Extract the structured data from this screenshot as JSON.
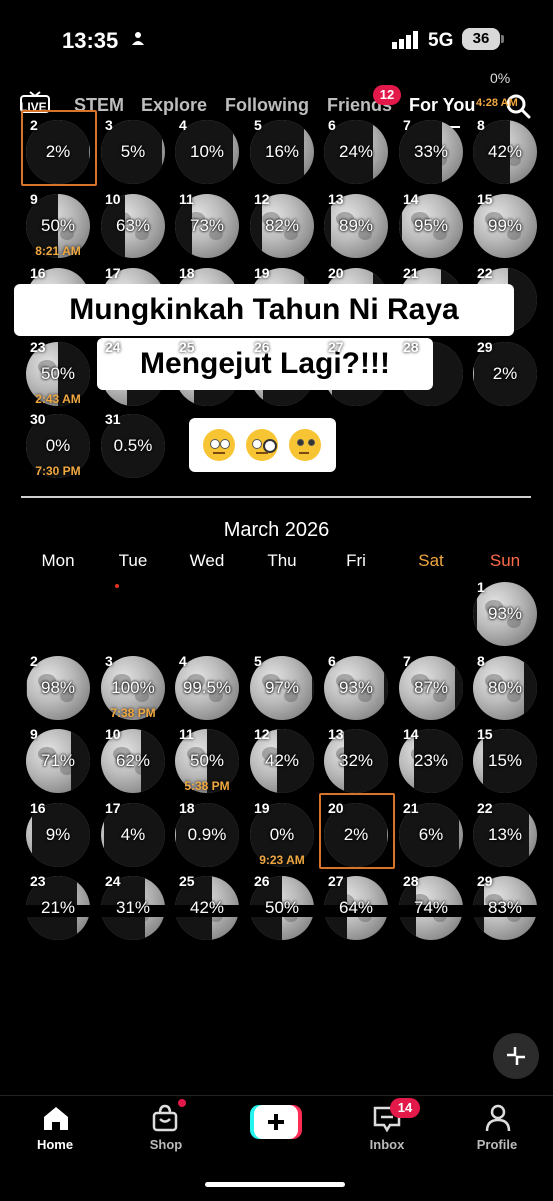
{
  "status": {
    "time": "13:35",
    "network": "5G",
    "battery": "36"
  },
  "nav": {
    "live": "LIVE",
    "tabs": [
      {
        "label": "STEM"
      },
      {
        "label": "Explore"
      },
      {
        "label": "Following"
      },
      {
        "label": "Friends",
        "badge": "12"
      },
      {
        "label": "For You",
        "active": true
      }
    ]
  },
  "calendar_top": {
    "partial_top_label": "0%",
    "partial_top_time": "4:28 AM",
    "rows": [
      [
        {
          "day": "2",
          "pct": "2%",
          "phase": 0.02,
          "waxing": true,
          "selected": true
        },
        {
          "day": "3",
          "pct": "5%",
          "phase": 0.05,
          "waxing": true
        },
        {
          "day": "4",
          "pct": "10%",
          "phase": 0.1,
          "waxing": true
        },
        {
          "day": "5",
          "pct": "16%",
          "phase": 0.16,
          "waxing": true
        },
        {
          "day": "6",
          "pct": "24%",
          "phase": 0.24,
          "waxing": true
        },
        {
          "day": "7",
          "pct": "33%",
          "phase": 0.33,
          "waxing": true
        },
        {
          "day": "8",
          "pct": "42%",
          "phase": 0.42,
          "waxing": true
        }
      ],
      [
        {
          "day": "9",
          "pct": "50%",
          "phase": 0.5,
          "waxing": true,
          "time": "8:21 AM"
        },
        {
          "day": "10",
          "pct": "63%",
          "phase": 0.63,
          "waxing": true
        },
        {
          "day": "11",
          "pct": "73%",
          "phase": 0.73,
          "waxing": true
        },
        {
          "day": "12",
          "pct": "82%",
          "phase": 0.82,
          "waxing": true
        },
        {
          "day": "13",
          "pct": "89%",
          "phase": 0.89,
          "waxing": true
        },
        {
          "day": "14",
          "pct": "95%",
          "phase": 0.95,
          "waxing": true
        },
        {
          "day": "15",
          "pct": "99%",
          "phase": 0.99,
          "waxing": true
        }
      ],
      [
        {
          "day": "16",
          "pct": "",
          "phase": 0.99,
          "waxing": false
        },
        {
          "day": "17",
          "pct": "",
          "phase": 0.97,
          "waxing": false
        },
        {
          "day": "18",
          "pct": "",
          "phase": 0.92,
          "waxing": false
        },
        {
          "day": "19",
          "pct": "",
          "phase": 0.85,
          "waxing": false
        },
        {
          "day": "20",
          "pct": "",
          "phase": 0.76,
          "waxing": false
        },
        {
          "day": "21",
          "pct": "",
          "phase": 0.66,
          "waxing": false
        },
        {
          "day": "22",
          "pct": "",
          "phase": 0.55,
          "waxing": false
        }
      ],
      [
        {
          "day": "23",
          "pct": "50%",
          "phase": 0.5,
          "waxing": false,
          "time": "2:43 AM"
        },
        {
          "day": "24",
          "pct": "",
          "phase": 0.4,
          "waxing": false
        },
        {
          "day": "25",
          "pct": "",
          "phase": 0.3,
          "waxing": false
        },
        {
          "day": "26",
          "pct": "",
          "phase": 0.21,
          "waxing": false
        },
        {
          "day": "27",
          "pct": "",
          "phase": 0.13,
          "waxing": false
        },
        {
          "day": "28",
          "pct": "",
          "phase": 0.06,
          "waxing": false
        },
        {
          "day": "29",
          "pct": "2%",
          "phase": 0.02,
          "waxing": false
        }
      ],
      [
        {
          "day": "30",
          "pct": "0%",
          "phase": 0.0,
          "waxing": false,
          "time": "7:30 PM"
        },
        {
          "day": "31",
          "pct": "0.5%",
          "phase": 0.005,
          "waxing": true
        }
      ]
    ]
  },
  "overlay": {
    "line1": "Mungkinkah Tahun Ni Raya",
    "line2": "Mengejut Lagi?!!!",
    "emojis": [
      "eye-roll-face",
      "monocle-face",
      "thinking-face"
    ]
  },
  "march": {
    "title": "March 2026",
    "weekdays": [
      "Mon",
      "Tue",
      "Wed",
      "Thu",
      "Fri",
      "Sat",
      "Sun"
    ],
    "weekend_color": "#f0a840",
    "sunday_color": "#ff6b4a",
    "rows": [
      [
        null,
        null,
        null,
        null,
        null,
        null,
        {
          "day": "1",
          "pct": "93%",
          "phase": 0.93,
          "waxing": true
        }
      ],
      [
        {
          "day": "2",
          "pct": "98%",
          "phase": 0.98,
          "waxing": true
        },
        {
          "day": "3",
          "pct": "100%",
          "phase": 1.0,
          "waxing": true,
          "time": "7:38 PM"
        },
        {
          "day": "4",
          "pct": "99.5%",
          "phase": 0.995,
          "waxing": false
        },
        {
          "day": "5",
          "pct": "97%",
          "phase": 0.97,
          "waxing": false
        },
        {
          "day": "6",
          "pct": "93%",
          "phase": 0.93,
          "waxing": false
        },
        {
          "day": "7",
          "pct": "87%",
          "phase": 0.87,
          "waxing": false
        },
        {
          "day": "8",
          "pct": "80%",
          "phase": 0.8,
          "waxing": false
        }
      ],
      [
        {
          "day": "9",
          "pct": "71%",
          "phase": 0.71,
          "waxing": false
        },
        {
          "day": "10",
          "pct": "62%",
          "phase": 0.62,
          "waxing": false
        },
        {
          "day": "11",
          "pct": "50%",
          "phase": 0.5,
          "waxing": false,
          "time": "5:38 PM"
        },
        {
          "day": "12",
          "pct": "42%",
          "phase": 0.42,
          "waxing": false
        },
        {
          "day": "13",
          "pct": "32%",
          "phase": 0.32,
          "waxing": false
        },
        {
          "day": "14",
          "pct": "23%",
          "phase": 0.23,
          "waxing": false
        },
        {
          "day": "15",
          "pct": "15%",
          "phase": 0.15,
          "waxing": false
        }
      ],
      [
        {
          "day": "16",
          "pct": "9%",
          "phase": 0.09,
          "waxing": false
        },
        {
          "day": "17",
          "pct": "4%",
          "phase": 0.04,
          "waxing": false
        },
        {
          "day": "18",
          "pct": "0.9%",
          "phase": 0.009,
          "waxing": false
        },
        {
          "day": "19",
          "pct": "0%",
          "phase": 0.0,
          "waxing": false,
          "time": "9:23 AM"
        },
        {
          "day": "20",
          "pct": "2%",
          "phase": 0.02,
          "waxing": true,
          "selected": true
        },
        {
          "day": "21",
          "pct": "6%",
          "phase": 0.06,
          "waxing": true
        },
        {
          "day": "22",
          "pct": "13%",
          "phase": 0.13,
          "waxing": true
        }
      ],
      [
        {
          "day": "23",
          "pct": "21%",
          "phase": 0.21,
          "waxing": true
        },
        {
          "day": "24",
          "pct": "31%",
          "phase": 0.31,
          "waxing": true
        },
        {
          "day": "25",
          "pct": "42%",
          "phase": 0.42,
          "waxing": true
        },
        {
          "day": "26",
          "pct": "50%",
          "phase": 0.5,
          "waxing": true
        },
        {
          "day": "27",
          "pct": "64%",
          "phase": 0.64,
          "waxing": true
        },
        {
          "day": "28",
          "pct": "74%",
          "phase": 0.74,
          "waxing": true
        },
        {
          "day": "29",
          "pct": "83%",
          "phase": 0.83,
          "waxing": true
        }
      ]
    ]
  },
  "tabbar": {
    "items": [
      {
        "label": "Home",
        "icon": "home-icon",
        "active": true
      },
      {
        "label": "Shop",
        "icon": "shop-icon",
        "dot": true
      },
      {
        "label": "",
        "icon": "plus-icon"
      },
      {
        "label": "Inbox",
        "icon": "inbox-icon",
        "badge": "14"
      },
      {
        "label": "Profile",
        "icon": "profile-icon"
      }
    ]
  },
  "colors": {
    "accent": "#e3194a",
    "select_border": "#d8742a",
    "time_text": "#f0a840"
  }
}
